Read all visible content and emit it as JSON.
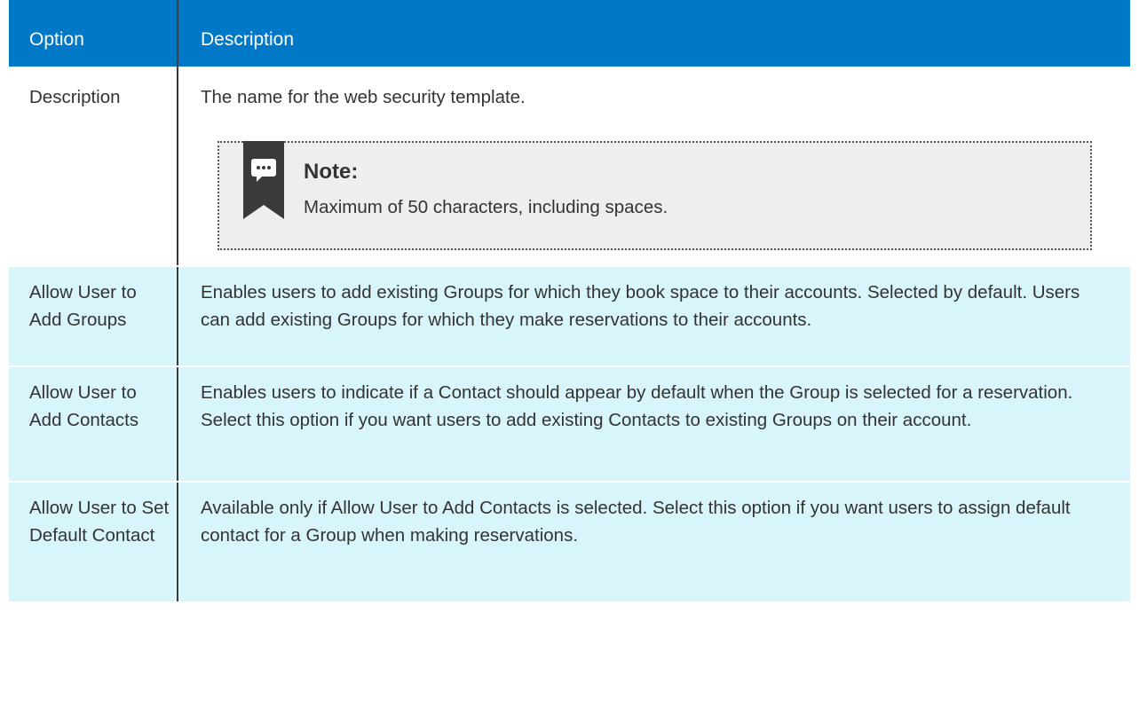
{
  "table": {
    "header": {
      "option": "Option",
      "description": "Description"
    },
    "rows": [
      {
        "option": "Description",
        "description": "The name for the web security template.",
        "note": {
          "title": "Note:",
          "text": "Maximum of 50 characters, including spaces.",
          "icon": "speech-bubble-bookmark-icon"
        }
      },
      {
        "option": "Allow User to Add Groups",
        "description": "Enables users to add existing Groups for which they book space to their accounts. Selected by default. Users can add existing Groups for which they make reservations to their accounts."
      },
      {
        "option": "Allow User to Add Contacts",
        "description": "Enables users to indicate if a Contact should appear by default when the Group is selected for a reservation. Select this option if you want users to add existing Contacts to existing Groups on their account."
      },
      {
        "option": "Allow User to Set Default Contact",
        "description": "Available only if Allow User to Add Contacts is selected. Select this option if you want users to assign default contact for a Group when making reservations."
      }
    ]
  },
  "colors": {
    "header_bg": "#0078c8",
    "alt_row_bg": "#d9f5fc",
    "note_bg": "#eeeeee",
    "text": "#333333"
  }
}
